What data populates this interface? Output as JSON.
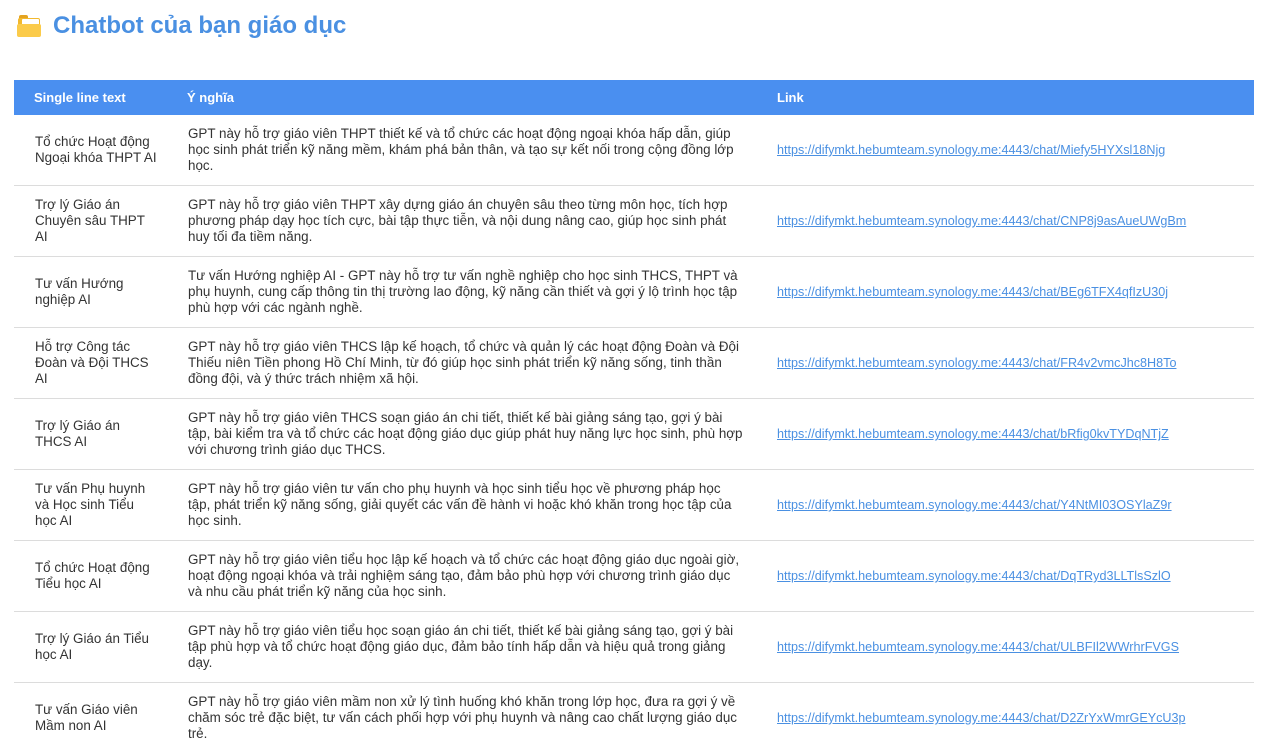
{
  "header": {
    "title": "Chatbot của bạn giáo dục",
    "icon": "folder-icon"
  },
  "table": {
    "columns": [
      "Single line text",
      "Ý nghĩa",
      "Link"
    ],
    "rows": [
      {
        "name": "Tổ chức Hoạt động Ngoại khóa THPT AI",
        "description": "GPT này hỗ trợ giáo viên THPT thiết kế và tổ chức các hoạt động ngoại khóa hấp dẫn, giúp học sinh phát triển kỹ năng mềm, khám phá bản thân, và tạo sự kết nối trong cộng đồng lớp học.",
        "link": "https://difymkt.hebumteam.synology.me:4443/chat/Miefy5HYXsl18Njg"
      },
      {
        "name": "Trợ lý Giáo án Chuyên sâu THPT AI",
        "description": "GPT này hỗ trợ giáo viên THPT xây dựng giáo án chuyên sâu theo từng môn học, tích hợp phương pháp dạy học tích cực, bài tập thực tiễn, và nội dung nâng cao, giúp học sinh phát huy tối đa tiềm năng.",
        "link": "https://difymkt.hebumteam.synology.me:4443/chat/CNP8j9asAueUWgBm"
      },
      {
        "name": "Tư vấn Hướng nghiệp AI",
        "description": "Tư vấn Hướng nghiệp AI - GPT này hỗ trợ tư vấn nghề nghiệp cho học sinh THCS, THPT và phụ huynh, cung cấp thông tin thị trường lao động, kỹ năng cần thiết và gợi ý lộ trình học tập phù hợp với các ngành nghề.",
        "link": "https://difymkt.hebumteam.synology.me:4443/chat/BEg6TFX4qfIzU30j"
      },
      {
        "name": "Hỗ trợ Công tác Đoàn và Đội THCS AI",
        "description": "GPT này hỗ trợ giáo viên THCS lập kế hoạch, tổ chức và quản lý các hoạt động Đoàn và Đội Thiếu niên Tiền phong Hồ Chí Minh, từ đó giúp học sinh phát triển kỹ năng sống, tinh thần đồng đội, và ý thức trách nhiệm xã hội.",
        "link": "https://difymkt.hebumteam.synology.me:4443/chat/FR4v2vmcJhc8H8To"
      },
      {
        "name": "Trợ lý Giáo án THCS AI",
        "description": "GPT này hỗ trợ giáo viên THCS soạn giáo án chi tiết, thiết kế bài giảng sáng tạo, gợi ý bài tập, bài kiểm tra và tổ chức các hoạt động giáo dục giúp phát huy năng lực học sinh, phù hợp với chương trình giáo dục THCS.",
        "link": "https://difymkt.hebumteam.synology.me:4443/chat/bRfig0kvTYDqNTjZ"
      },
      {
        "name": "Tư vấn Phụ huynh và Học sinh Tiểu học AI",
        "description": "GPT này hỗ trợ giáo viên tư vấn cho phụ huynh và học sinh tiểu học về phương pháp học tập, phát triển kỹ năng sống, giải quyết các vấn đề hành vi hoặc khó khăn trong học tập của học sinh.",
        "link": "https://difymkt.hebumteam.synology.me:4443/chat/Y4NtMI03OSYlaZ9r"
      },
      {
        "name": "Tổ chức Hoạt động Tiểu học AI",
        "description": "GPT này hỗ trợ giáo viên tiểu học lập kế hoạch và tổ chức các hoạt động giáo dục ngoài giờ, hoạt động ngoại khóa và trải nghiệm sáng tạo, đảm bảo phù hợp với chương trình giáo dục và nhu cầu phát triển kỹ năng của học sinh.",
        "link": "https://difymkt.hebumteam.synology.me:4443/chat/DqTRyd3LLTlsSzlO"
      },
      {
        "name": "Trợ lý Giáo án Tiểu học AI",
        "description": "GPT này hỗ trợ giáo viên tiểu học soạn giáo án chi tiết, thiết kế bài giảng sáng tạo, gợi ý bài tập phù hợp và tổ chức hoạt động giáo dục, đảm bảo tính hấp dẫn và hiệu quả trong giảng dạy.",
        "link": "https://difymkt.hebumteam.synology.me:4443/chat/ULBFIl2WWrhrFVGS"
      },
      {
        "name": "Tư vấn Giáo viên Mầm non AI",
        "description": "GPT này hỗ trợ giáo viên mầm non xử lý tình huống khó khăn trong lớp học, đưa ra gợi ý về chăm sóc trẻ đặc biệt, tư vấn cách phối hợp với phụ huynh và nâng cao chất lượng giáo dục trẻ.",
        "link": "https://difymkt.hebumteam.synology.me:4443/chat/D2ZrYxWmrGEYcU3p"
      }
    ]
  },
  "colors": {
    "title": "#4a90e2",
    "header_bg": "#4a8ff0",
    "link": "#4a90e2",
    "row_border": "#dcdcdc"
  }
}
